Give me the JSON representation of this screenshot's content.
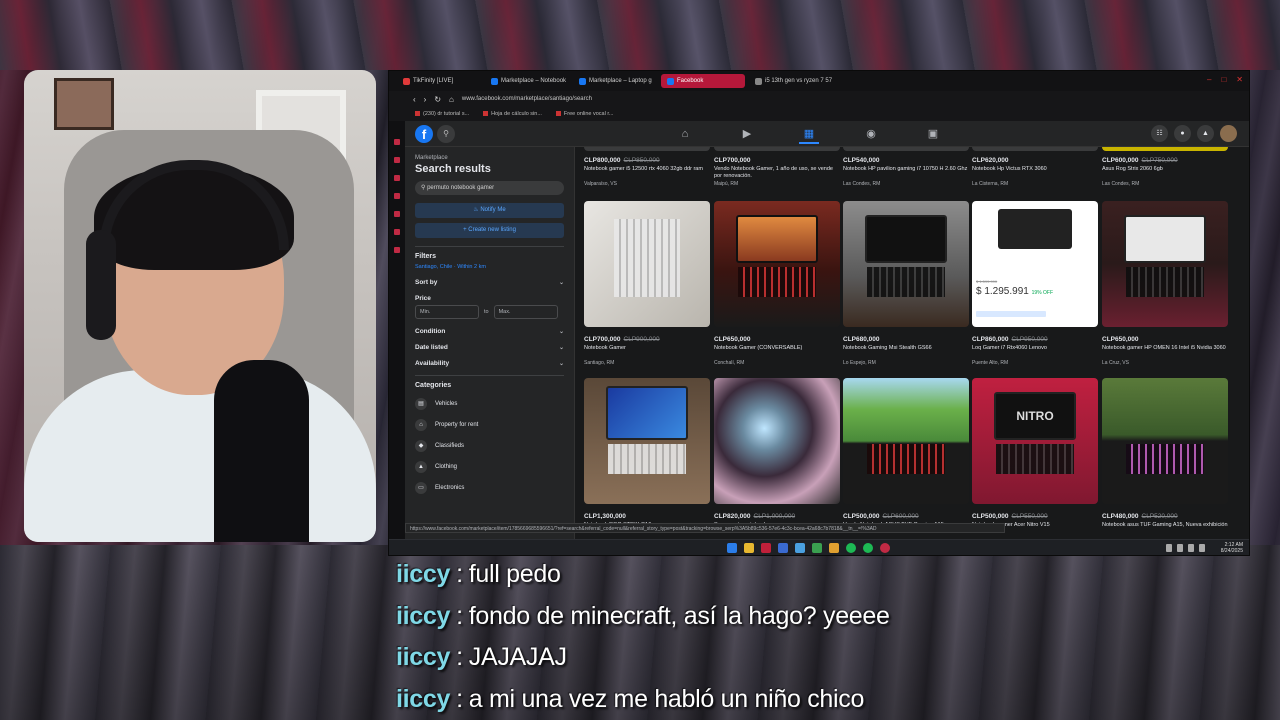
{
  "browser": {
    "tabs": [
      {
        "label": "TikFinity [LIVE]",
        "color": "#e03a3a",
        "active": false
      },
      {
        "label": "Marketplace – Notebook",
        "color": "#1877f2",
        "active": false
      },
      {
        "label": "Marketplace – Laptop g",
        "color": "#1877f2",
        "active": false
      },
      {
        "label": "Facebook",
        "color": "#1877f2",
        "active": true
      },
      {
        "label": "i5 13th gen vs ryzen 7 57",
        "color": "#888888",
        "active": false
      }
    ],
    "url": "www.facebook.com/marketplace/santiago/search",
    "bookmarks": [
      "(230) dr tutorial s...",
      "Hoja de cálculo sin...",
      "Free online vocal r..."
    ],
    "status_url": "https://www.facebook.com/marketplace/item/1785669685596651/?ref=search&referral_code=null&referral_story_type=post&tracking=browse_serp%3A5b89c536-57e6-4c3c-bcea-42a68c7b7818&__tn__=!%3AD"
  },
  "sidebar": {
    "breadcrumb": "Marketplace",
    "title": "Search results",
    "search_value": "permuto notebook gamer",
    "notify_label": "Notify Me",
    "create_label": "+ Create new listing",
    "filters_label": "Filters",
    "location": "Santiago, Chile · Within 2 km",
    "sort_label": "Sort by",
    "price_label": "Price",
    "min_placeholder": "Min.",
    "to_label": "to",
    "max_placeholder": "Max.",
    "condition_label": "Condition",
    "date_label": "Date listed",
    "availability_label": "Availability",
    "categories_label": "Categories",
    "categories": [
      "Vehicles",
      "Property for rent",
      "Classifieds",
      "Clothing",
      "Electronics"
    ]
  },
  "listings_top": [
    {
      "price": "CLP800,000",
      "old": "CLP850,000",
      "name": "Notebook gamer i5 12500 rtx 4060 32gb ddr ram",
      "loc": "Valparaíso, VS"
    },
    {
      "price": "CLP700,000",
      "old": "",
      "name": "Vendo Notebook Gamer, 1 año de uso, se vende por renovación.",
      "loc": "Maipú, RM"
    },
    {
      "price": "CLP540,000",
      "old": "",
      "name": "Notebook HP pavilion gaming i7 10750 H 2.60 Ghz",
      "loc": "Las Condes, RM"
    },
    {
      "price": "CLP620,000",
      "old": "",
      "name": "Notebook Hp Victus RTX 3060",
      "loc": "La Cisterna, RM"
    },
    {
      "price": "CLP600,000",
      "old": "CLP750,000",
      "name": "Asus Rog Strix 2060 6gb",
      "loc": "Las Condes, RM"
    }
  ],
  "listings_mid": [
    {
      "price": "CLP700,000",
      "old": "CLP900,000",
      "name": "Notebook Gamer",
      "loc": "Santiago, RM"
    },
    {
      "price": "CLP650,000",
      "old": "",
      "name": "Notebook Gamer (CONVERSABLE)",
      "loc": "Conchalí, RM"
    },
    {
      "price": "CLP680,000",
      "old": "",
      "name": "Notebook Gaming Msi Stealth GS66",
      "loc": "Lo Espejo, RM"
    },
    {
      "price": "CLP860,000",
      "old": "CLP950,000",
      "name": "Loq Gamer i7 Rtx4060 Lenovo",
      "loc": "Puente Alto, RM"
    },
    {
      "price": "CLP650,000",
      "old": "",
      "name": "Notebook gamer HP OMEN 16 Intel i5 Nvidia 3060",
      "loc": "La Cruz, VS"
    }
  ],
  "listings_bottom": [
    {
      "price": "CLP1,300,000",
      "old": "",
      "name": "Notebook ROG STRIX G16",
      "loc": ""
    },
    {
      "price": "CLP820,000",
      "old": "CLP1,000,000",
      "name": "Se permuta notebook gamer",
      "loc": ""
    },
    {
      "price": "CLP500,000",
      "old": "CLP600,000",
      "name": "Vendo Notebook ASUS TUF Gaming A15",
      "loc": ""
    },
    {
      "price": "CLP500,000",
      "old": "CLP550,000",
      "name": "Notebook gamer Acer Nitro V15",
      "loc": ""
    },
    {
      "price": "CLP480,000",
      "old": "CLP520,000",
      "name": "Notebook asus TUF Gaming A15, Nueva exhibición",
      "loc": ""
    }
  ],
  "loq_promo": {
    "price": "$ 1.295.991",
    "discount": "19% OFF",
    "old": "$ 1.599.990"
  },
  "taskbar": {
    "time": "2:12 AM",
    "date": "8/24/2025"
  },
  "chat": [
    {
      "user": "iiccy",
      "message": "full pedo"
    },
    {
      "user": "iiccy",
      "message": "fondo de minecraft, así la hago? yeeee"
    },
    {
      "user": "iiccy",
      "message": "JAJAJAJ"
    },
    {
      "user": "iiccy",
      "message": "a mi una vez me habló un niño chico"
    }
  ],
  "colors": {
    "facebook_blue": "#1877f2",
    "chat_username": "#7fd8e6",
    "tab_active": "#b5183a"
  }
}
